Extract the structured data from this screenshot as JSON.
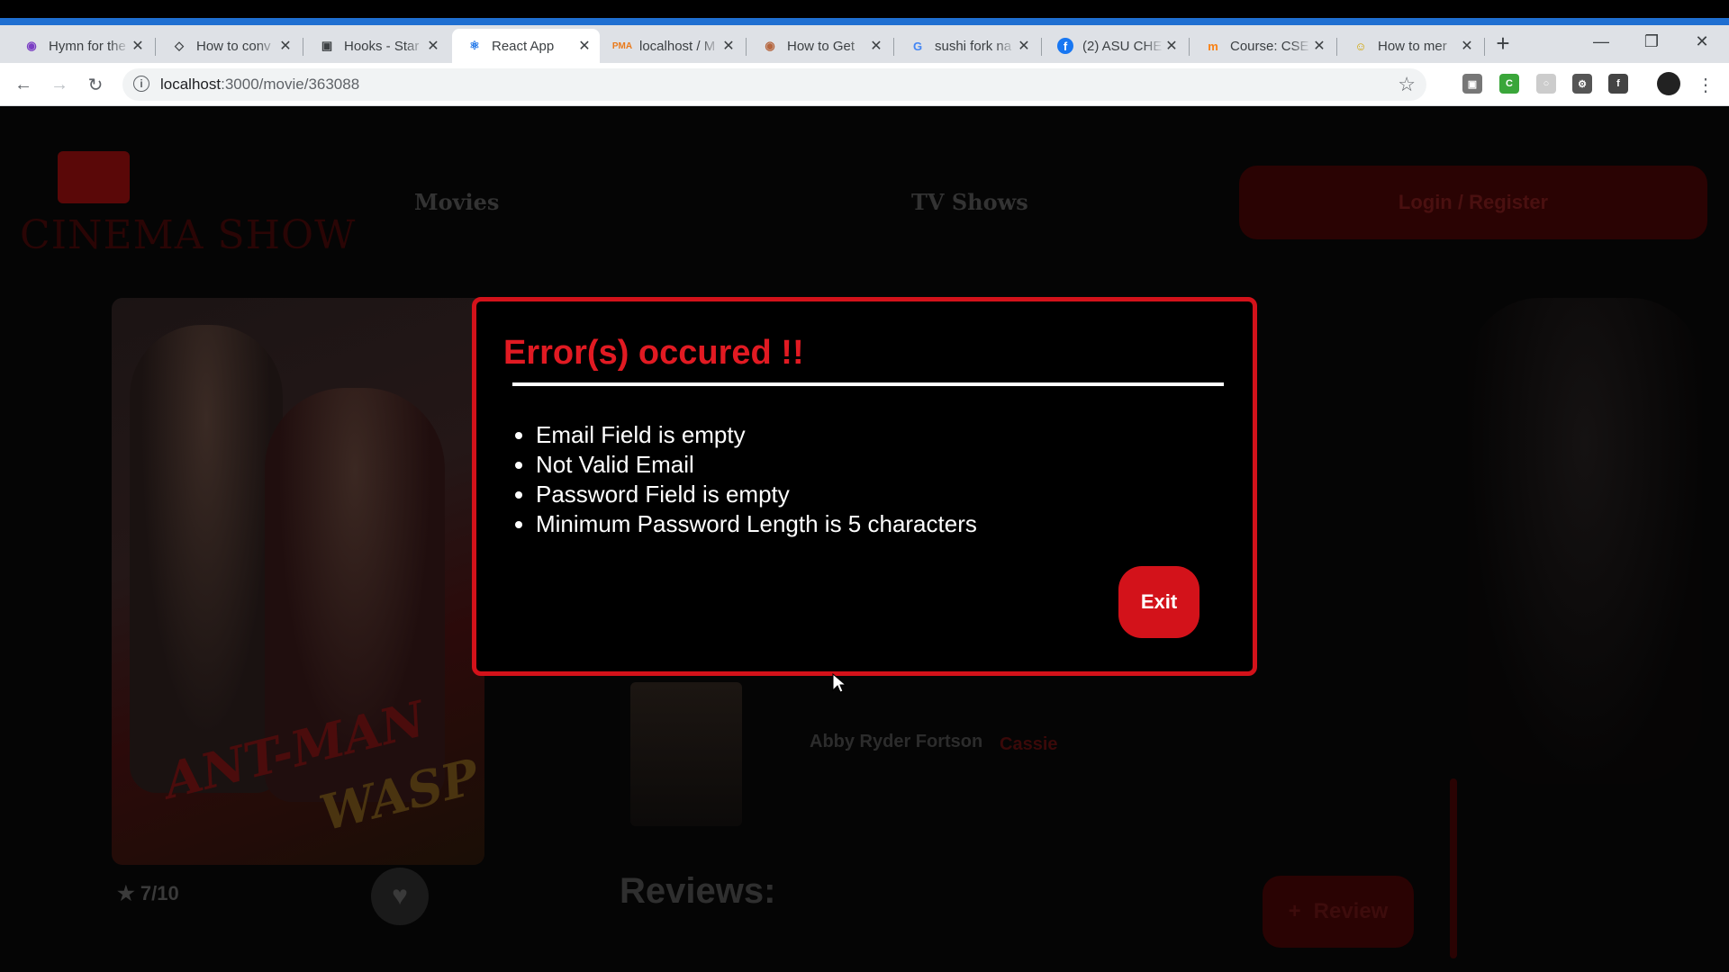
{
  "browser": {
    "tabs": [
      {
        "title": "Hymn for the",
        "icon": "music-icon",
        "active": false
      },
      {
        "title": "How to conv",
        "icon": "diamond-icon",
        "active": false
      },
      {
        "title": "Hooks - Star",
        "icon": "box-icon",
        "active": false
      },
      {
        "title": "React App",
        "icon": "react-icon",
        "active": true
      },
      {
        "title": "localhost / M",
        "icon": "phpmyadmin-icon",
        "active": false
      },
      {
        "title": "How to Get",
        "icon": "github-icon",
        "active": false
      },
      {
        "title": "sushi fork na",
        "icon": "google-icon",
        "active": false
      },
      {
        "title": "(2) ASU CHE",
        "icon": "facebook-icon",
        "active": false
      },
      {
        "title": "Course: CSE",
        "icon": "moodle-icon",
        "active": false
      },
      {
        "title": "How to mer",
        "icon": "smiley-icon",
        "active": false
      }
    ],
    "url_host": "localhost",
    "url_path": ":3000/movie/363088"
  },
  "header": {
    "logo_text": "CINEMA SHOW",
    "nav": [
      {
        "label": "Movies"
      },
      {
        "label": "TV Shows"
      }
    ],
    "login_label": "Login / Register"
  },
  "movie": {
    "poster_title_1": "ANT-MAN",
    "poster_title_2": "WASP",
    "rating": "7",
    "rating_max": "/10",
    "actor_name": "Abby Ryder Fortson",
    "actor_role": "Cassie",
    "reviews_heading": "Reviews:",
    "review_button": "Review"
  },
  "modal": {
    "title": "Error(s) occured !!",
    "errors": [
      "Email Field is empty",
      "Not Valid Email",
      "Password Field is empty",
      "Minimum Password Length is 5 characters"
    ],
    "exit_label": "Exit",
    "border_color": "#d3121a"
  }
}
